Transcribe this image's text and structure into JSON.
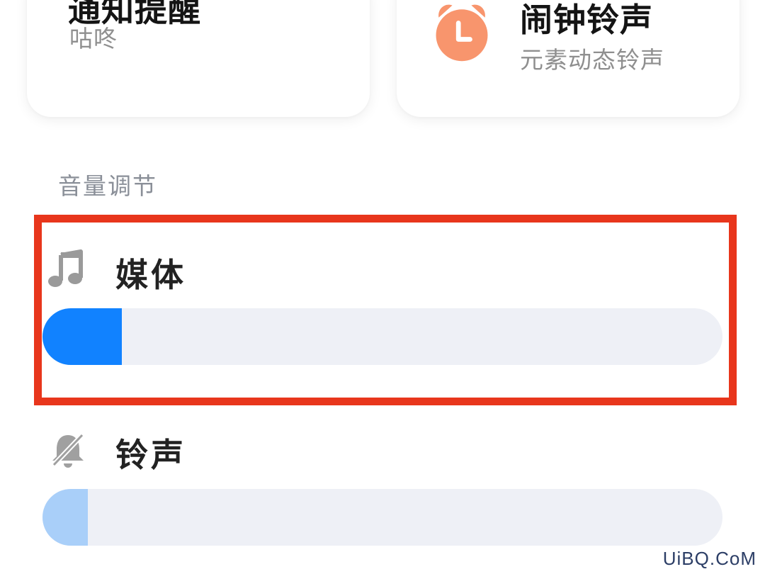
{
  "cards": {
    "notification": {
      "title": "通知提醒",
      "subtitle": "咕咚"
    },
    "alarm": {
      "title": "闹钟铃声",
      "subtitle": "元素动态铃声",
      "icon": "alarm-clock-icon",
      "icon_color": "#f8956d"
    }
  },
  "volume": {
    "section_title": "音量调节",
    "media": {
      "label": "媒体",
      "icon": "music-note-icon",
      "level": 0.117,
      "fill_color": "#1182ff"
    },
    "ringtone": {
      "label": "铃声",
      "icon": "bell-muted-icon",
      "level": 0.067,
      "fill_color": "#a9cff9"
    },
    "track_color": "#eef0f6",
    "highlight_color": "#e8361c"
  },
  "watermark": "UiBQ.CoM"
}
